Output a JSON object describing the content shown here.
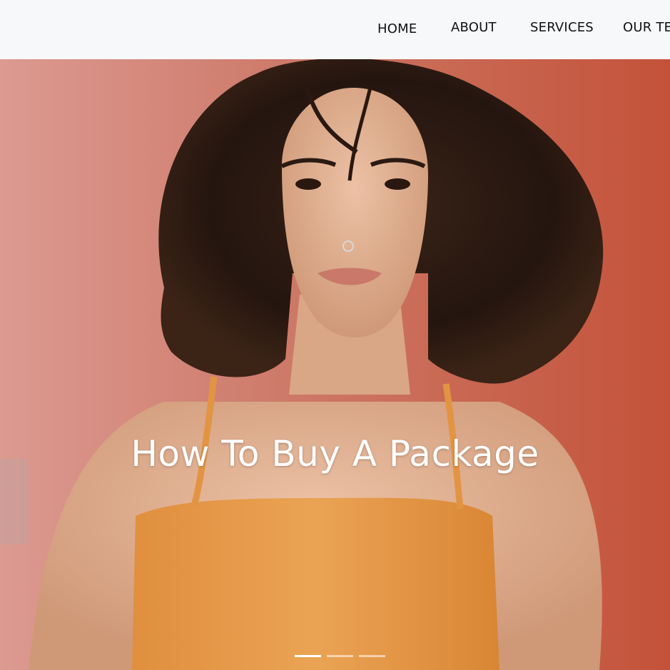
{
  "nav": {
    "items": [
      {
        "label": "HOME"
      },
      {
        "label": "ABOUT"
      },
      {
        "label": "SERVICES"
      },
      {
        "label": "OUR TE"
      }
    ]
  },
  "hero": {
    "title": "How To Buy A Package",
    "active_slide": 1,
    "slide_count": 3
  },
  "colors": {
    "wall_left": "#d8938a",
    "wall_right": "#c65a41",
    "hair": "#2a1a14",
    "skin": "#e0b194",
    "top": "#e59a4a"
  }
}
